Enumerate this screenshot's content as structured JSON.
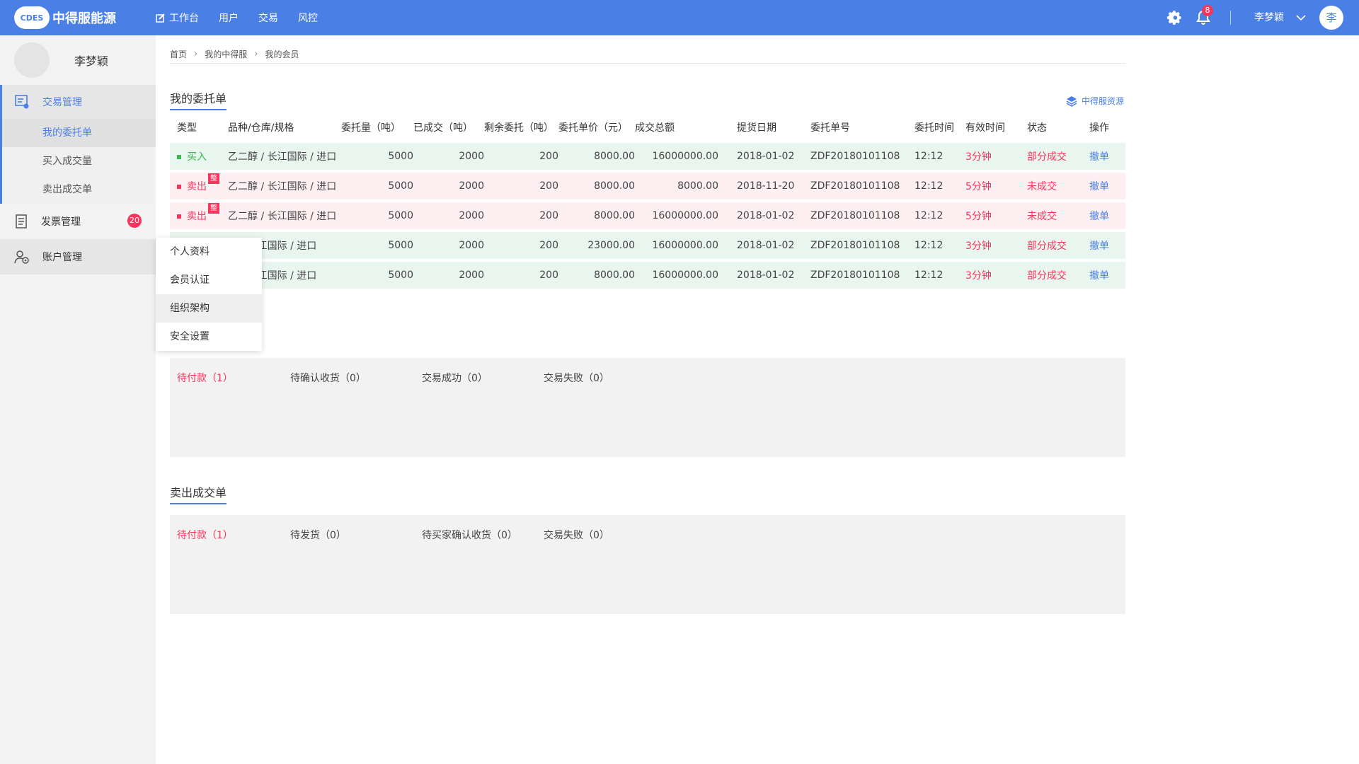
{
  "topbar": {
    "logo_mark": "CDES",
    "brand": "中得服能源",
    "nav": [
      "工作台",
      "用户",
      "交易",
      "风控"
    ],
    "notifications": "8",
    "username": "李梦颖",
    "avatar_letter": "李"
  },
  "sidebar": {
    "profile_name": "李梦颖",
    "trade_group": "交易管理",
    "trade_items": [
      "我的委托单",
      "买入成交量",
      "卖出成交单"
    ],
    "invoice": "发票管理",
    "invoice_badge": "20",
    "account": "账户管理"
  },
  "account_menu": [
    "个人资料",
    "会员认证",
    "组织架构",
    "安全设置"
  ],
  "breadcrumb": [
    "首页",
    "我的中得服",
    "我的会员"
  ],
  "orders": {
    "title": "我的委托单",
    "resource_link": "中得服资源",
    "headers": [
      "类型",
      "品种/仓库/规格",
      "委托量（吨）",
      "已成交（吨）",
      "剩余委托（吨）",
      "委托单价（元）",
      "成交总额",
      "提货日期",
      "委托单号",
      "委托时间",
      "有效时间",
      "状态",
      "操作"
    ],
    "rows": [
      {
        "kind": "buy",
        "type": "买入",
        "tag": "",
        "spec": "乙二醇 / 长江国际 / 进口",
        "qty": "5000",
        "done": "2000",
        "remain": "200",
        "price": "8000.00",
        "total": "16000000.00",
        "date": "2018-01-02",
        "no": "ZDF20180101108",
        "time": "12:12",
        "valid": "3分钟",
        "status": "部分成交",
        "action": "撤单"
      },
      {
        "kind": "sell",
        "type": "卖出",
        "tag": "整",
        "spec": "乙二醇 / 长江国际 / 进口",
        "qty": "5000",
        "done": "2000",
        "remain": "200",
        "price": "8000.00",
        "total": "8000.00",
        "date": "2018-11-20",
        "no": "ZDF20180101108",
        "time": "12:12",
        "valid": "5分钟",
        "status": "未成交",
        "action": "撤单"
      },
      {
        "kind": "sell",
        "type": "卖出",
        "tag": "整",
        "spec": "乙二醇 / 长江国际 / 进口",
        "qty": "5000",
        "done": "2000",
        "remain": "200",
        "price": "8000.00",
        "total": "16000000.00",
        "date": "2018-01-02",
        "no": "ZDF20180101108",
        "time": "12:12",
        "valid": "5分钟",
        "status": "未成交",
        "action": "撤单"
      },
      {
        "kind": "buy",
        "type": "",
        "tag": "",
        "spec": "醇 / 长江国际 / 进口",
        "qty": "5000",
        "done": "2000",
        "remain": "200",
        "price": "23000.00",
        "total": "16000000.00",
        "date": "2018-01-02",
        "no": "ZDF20180101108",
        "time": "12:12",
        "valid": "3分钟",
        "status": "部分成交",
        "action": "撤单"
      },
      {
        "kind": "buy",
        "type": "",
        "tag": "",
        "spec": "醇 / 长江国际 / 进口",
        "qty": "5000",
        "done": "2000",
        "remain": "200",
        "price": "8000.00",
        "total": "16000000.00",
        "date": "2018-01-02",
        "no": "ZDF20180101108",
        "time": "12:12",
        "valid": "3分钟",
        "status": "部分成交",
        "action": "撤单"
      }
    ]
  },
  "buy_panel": {
    "tabs": [
      "待付款（1）",
      "待确认收货（0）",
      "交易成功（0）",
      "交易失败（0）"
    ]
  },
  "sell_section": {
    "title": "卖出成交单",
    "tabs": [
      "待付款（1）",
      "待发货（0）",
      "待买家确认收货（0）",
      "交易失败（0）"
    ]
  }
}
